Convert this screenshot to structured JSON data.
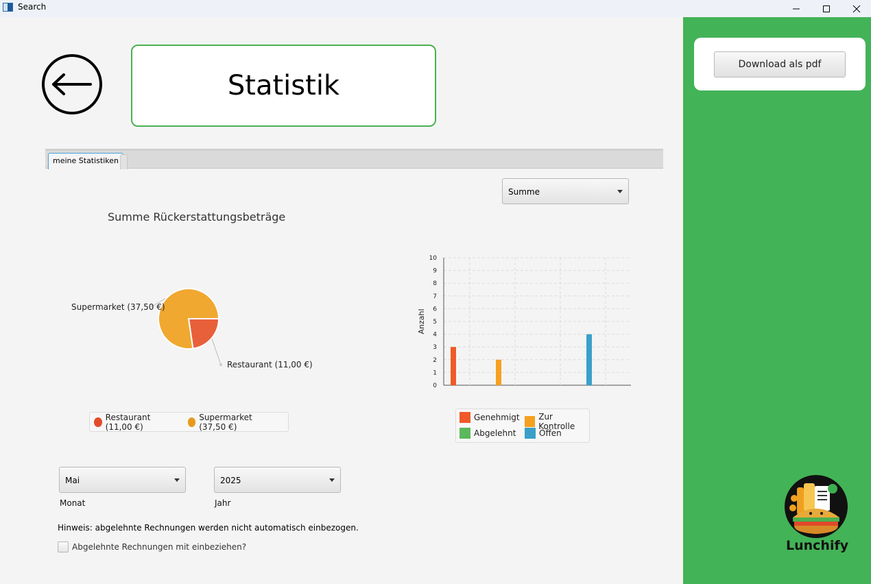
{
  "window": {
    "title": "Search",
    "controls": [
      "minimize",
      "maximize",
      "close"
    ]
  },
  "header": {
    "back_icon": "arrow-left-circle-icon",
    "title": "Statistik"
  },
  "tabs": [
    {
      "label": "meine Statistiken",
      "active": true
    }
  ],
  "mode_select": {
    "value": "Summe"
  },
  "pie_chart": {
    "title": "Summe Rückerstattungsbeträge",
    "slice_labels": [
      "Supermarket (37,50 €)",
      "Restaurant (11,00 €)"
    ],
    "legend": [
      "Restaurant (11,00 €)",
      "Supermarket (37,50 €)"
    ]
  },
  "bar_chart": {
    "ylabel": "Anzahl",
    "yticks": [
      "0",
      "1",
      "2",
      "3",
      "4",
      "5",
      "6",
      "7",
      "8",
      "9",
      "10"
    ],
    "legend": [
      "Genehmigt",
      "Zur Kontrolle",
      "Abgelehnt",
      "Offen"
    ]
  },
  "chart_data": [
    {
      "type": "pie",
      "title": "Summe Rückerstattungsbeträge",
      "categories": [
        "Restaurant",
        "Supermarket"
      ],
      "values": [
        11.0,
        37.5
      ],
      "labels": [
        "Restaurant (11,00 €)",
        "Supermarket (37,50 €)"
      ],
      "colors": [
        "#e8603a",
        "#f0a020"
      ],
      "legend_position": "bottom"
    },
    {
      "type": "bar",
      "ylabel": "Anzahl",
      "ylim": [
        0,
        10
      ],
      "grid": true,
      "legend_position": "bottom",
      "series": [
        {
          "name": "Genehmigt",
          "values": [
            3
          ],
          "color": "#f05a28"
        },
        {
          "name": "Zur Kontrolle",
          "values": [
            2
          ],
          "color": "#f5a020"
        },
        {
          "name": "Abgelehnt",
          "values": [
            0
          ],
          "color": "#5cb85c"
        },
        {
          "name": "Offen",
          "values": [
            4
          ],
          "color": "#3aa0c8"
        }
      ]
    }
  ],
  "filters": {
    "month": {
      "value": "Mai",
      "label": "Monat"
    },
    "year": {
      "value": "2025",
      "label": "Jahr"
    }
  },
  "hint": "Hinweis: abgelehnte Rechnungen werden nicht automatisch einbezogen.",
  "include_rejected": {
    "label": "Abgelehnte Rechnungen mit einbeziehen?",
    "checked": false
  },
  "sidebar": {
    "download_label": "Download als pdf",
    "logo_text": "Lunchify"
  }
}
